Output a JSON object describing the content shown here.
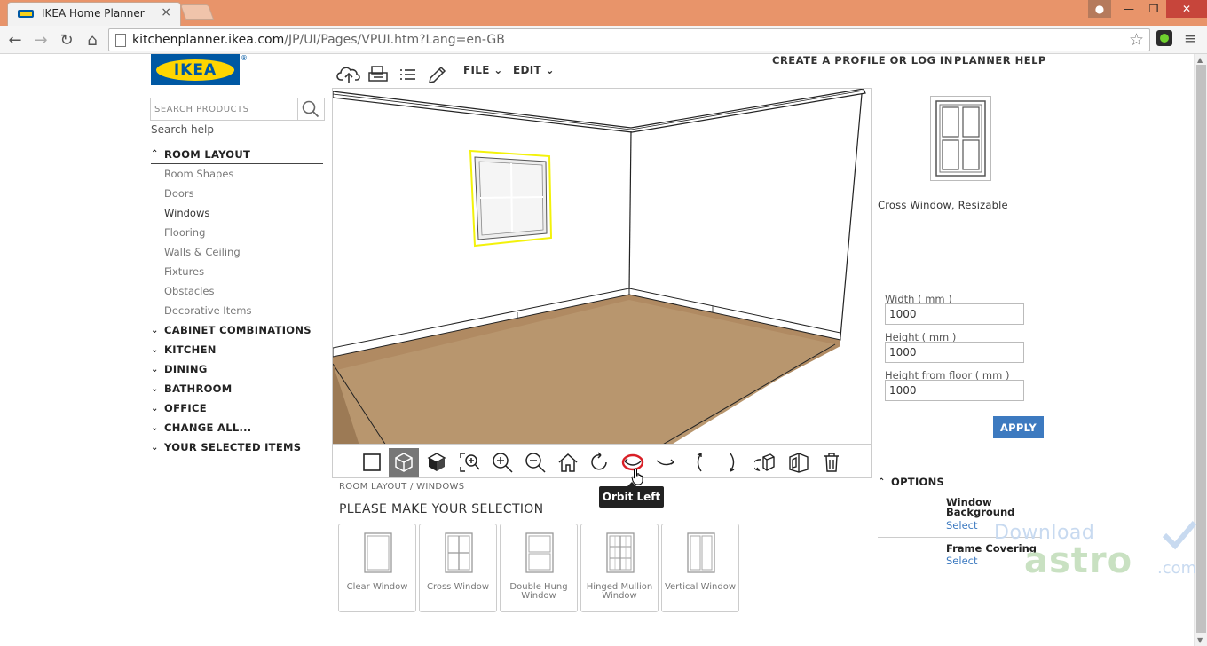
{
  "browser": {
    "tab_title": "IKEA Home Planner",
    "tab_close": "×",
    "url_host": "kitchenplanner.ikea.com",
    "url_path": "/JP/UI/Pages/VPUI.htm?Lang=en-GB"
  },
  "header": {
    "logo_text": "IKEA",
    "logo_reg": "®",
    "create_profile": "CREATE A PROFILE OR LOG IN",
    "planner_help": "PLANNER HELP",
    "file_menu": "FILE",
    "edit_menu": "EDIT"
  },
  "search": {
    "placeholder": "SEARCH PRODUCTS",
    "help": "Search help"
  },
  "sidebar": {
    "room_layout": "ROOM LAYOUT",
    "room_layout_items": [
      "Room Shapes",
      "Doors",
      "Windows",
      "Flooring",
      "Walls & Ceiling",
      "Fixtures",
      "Obstacles",
      "Decorative Items"
    ],
    "sections": [
      "CABINET COMBINATIONS",
      "KITCHEN",
      "DINING",
      "BATHROOM",
      "OFFICE",
      "CHANGE ALL...",
      "YOUR SELECTED ITEMS"
    ]
  },
  "viewbar": {
    "tooltip": "Orbit Left"
  },
  "selection": {
    "breadcrumb": "ROOM LAYOUT / WINDOWS",
    "title": "PLEASE MAKE YOUR SELECTION",
    "cards": [
      {
        "label": "Clear Window"
      },
      {
        "label": "Cross Window"
      },
      {
        "label": "Double Hung Window"
      },
      {
        "label": "Hinged Mullion Window"
      },
      {
        "label": "Vertical Window"
      }
    ]
  },
  "product": {
    "name": "Cross Window, Resizable",
    "width_label": "Width ( mm )",
    "width_value": "1000",
    "height_label": "Height ( mm )",
    "height_value": "1000",
    "floor_label": "Height from floor ( mm )",
    "floor_value": "1000",
    "apply": "APPLY"
  },
  "options": {
    "title": "OPTIONS",
    "items": [
      {
        "title": "Window Background",
        "link": "Select"
      },
      {
        "title": "Frame Covering",
        "link": "Select"
      }
    ]
  },
  "watermark": {
    "small": "Download",
    "big": "astro",
    "com": ".com"
  },
  "colors": {
    "titlebar": "#e8946a",
    "ikea_blue": "#0058a3",
    "ikea_yellow": "#ffd500",
    "apply_blue": "#3d7ac0",
    "floor": "#b08a62"
  }
}
